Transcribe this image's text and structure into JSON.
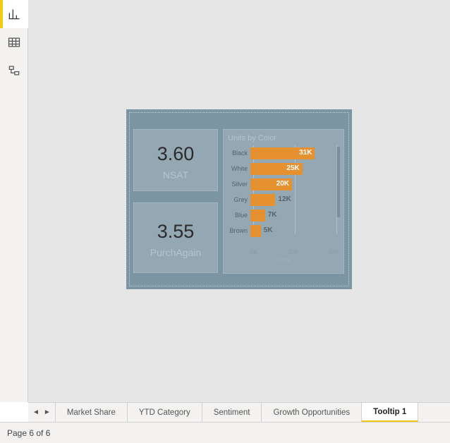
{
  "rail": {
    "items": [
      "report-view",
      "data-view",
      "model-view"
    ],
    "active": 0
  },
  "cards": {
    "nsat": {
      "value": "3.60",
      "label": "NSAT"
    },
    "purch": {
      "value": "3.55",
      "label": "PurchAgain"
    }
  },
  "chart_data": {
    "type": "bar",
    "title": "Units by Color",
    "xlabel": "Units",
    "ylabel": "",
    "xlim": [
      0,
      40000
    ],
    "ticks": [
      "0K",
      "20K",
      "40K"
    ],
    "categories": [
      "Black",
      "White",
      "Silver",
      "Grey",
      "Blue",
      "Brown"
    ],
    "values": [
      31000,
      25000,
      20000,
      12000,
      7000,
      5000
    ],
    "value_labels": [
      "31K",
      "25K",
      "20K",
      "12K",
      "7K",
      "5K"
    ]
  },
  "tabs": {
    "items": [
      "Market Share",
      "YTD Category",
      "Sentiment",
      "Growth Opportunities",
      "Tooltip 1"
    ],
    "active": 4
  },
  "status": {
    "page": "Page 6 of 6"
  },
  "colors": {
    "accent": "#f2c811",
    "bar": "#e6912f",
    "page": "#7b95a3",
    "tile": "#93a8b3"
  }
}
